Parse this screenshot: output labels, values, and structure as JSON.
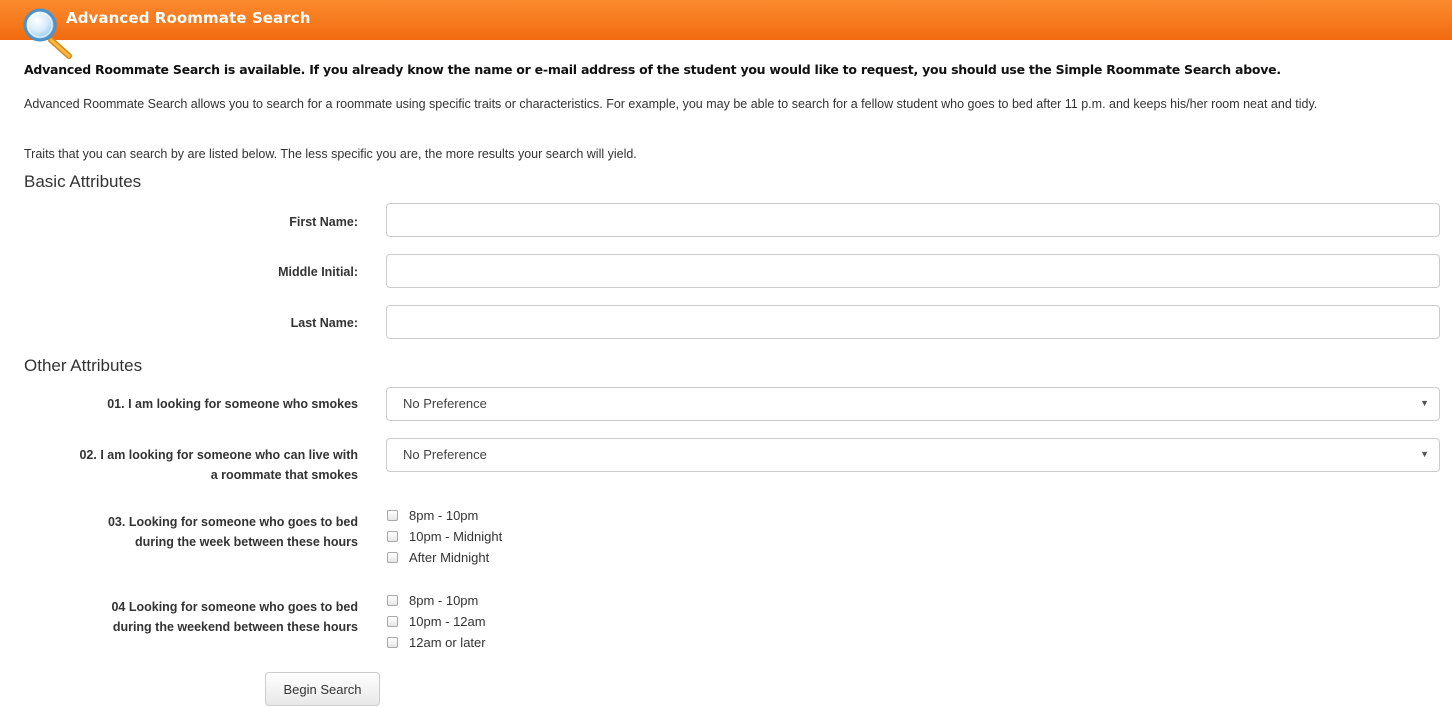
{
  "header": {
    "title": "Advanced Roommate Search",
    "icon": "magnifier-icon"
  },
  "intro": {
    "bold_notice": "Advanced Roommate Search is available. If you already know the name or e-mail address of the student you would like to request, you should use the Simple Roommate Search above.",
    "description": "Advanced Roommate Search allows you to search for a roommate using specific traits or characteristics. For example, you may be able to search for a fellow student who goes to bed after 11 p.m. and keeps his/her room neat and tidy.",
    "traits_note": "Traits that you can search by are listed below. The less specific you are, the more results your search will yield."
  },
  "basic": {
    "title": "Basic Attributes",
    "first_name_label": "First Name:",
    "first_name_value": "",
    "middle_initial_label": "Middle Initial:",
    "middle_initial_value": "",
    "last_name_label": "Last Name:",
    "last_name_value": ""
  },
  "other": {
    "title": "Other Attributes",
    "q1_label": "01. I am looking for someone who smokes",
    "q1_value": "No Preference",
    "q2_label_line1": "02. I am looking for someone who can live with",
    "q2_label_line2": "a roommate that smokes",
    "q2_value": "No Preference",
    "q3_label_line1": "03. Looking for someone who goes to bed",
    "q3_label_line2": "during the week between these hours",
    "q3_options": [
      "8pm - 10pm",
      "10pm - Midnight",
      "After Midnight"
    ],
    "q4_label_line1": "04 Looking for someone who goes to bed",
    "q4_label_line2": "during the weekend between these hours",
    "q4_options": [
      "8pm - 10pm",
      "10pm - 12am",
      "12am or later"
    ]
  },
  "actions": {
    "search_label": "Begin Search"
  },
  "colors": {
    "header_orange": "#f47a1f"
  }
}
